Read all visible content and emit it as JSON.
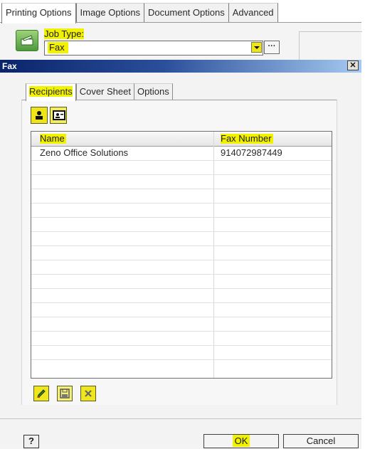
{
  "outer": {
    "tabs": [
      "Printing Options",
      "Image Options",
      "Document Options",
      "Advanced"
    ],
    "active_tab": "Printing Options",
    "job_type_label": "Job Type:",
    "job_type_value": "Fax",
    "more_button_label": "···",
    "icons": {
      "job_type": "printer-arrow-icon",
      "dropdown": "chevron-down-icon"
    }
  },
  "dialog": {
    "title": "Fax",
    "close_label": "✕",
    "tabs": [
      "Recipients",
      "Cover Sheet",
      "Options"
    ],
    "active_tab": "Recipients",
    "toolbar_icons": [
      "person-icon",
      "address-book-icon"
    ],
    "table": {
      "columns": [
        "Name",
        "Fax Number"
      ],
      "rows": [
        {
          "name": "Zeno Office Solutions",
          "fax": "914072987449"
        }
      ]
    },
    "footer_icons": [
      "edit-pencil-icon",
      "save-disk-icon",
      "delete-x-icon"
    ],
    "help_label": "?",
    "ok_label": "OK",
    "cancel_label": "Cancel"
  },
  "colors": {
    "highlight": "#f2f200",
    "title_bar_start": "#0a246a",
    "title_bar_end": "#a6caf0",
    "button_yellow": "#efe41a"
  }
}
